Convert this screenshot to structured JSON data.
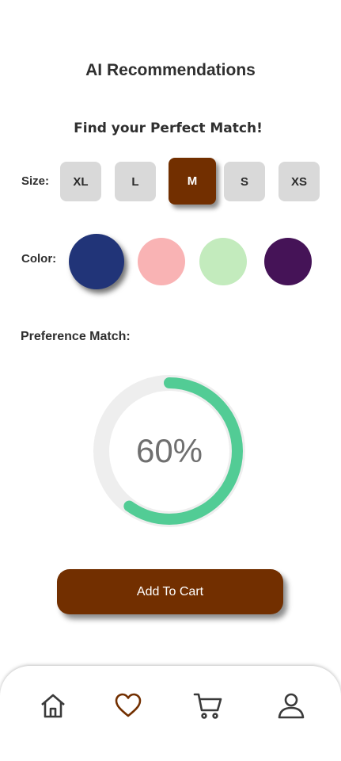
{
  "header": {
    "title": "AI Recommendations"
  },
  "subtitle": "Find your Perfect Match!",
  "size": {
    "label": "Size:",
    "options": [
      "XL",
      "L",
      "M",
      "S",
      "XS"
    ],
    "selected": "M"
  },
  "color": {
    "label": "Color:",
    "options": [
      {
        "name": "navy",
        "hex": "#213478"
      },
      {
        "name": "pink",
        "hex": "#f9b3b4"
      },
      {
        "name": "light-green",
        "hex": "#c3ebbd"
      },
      {
        "name": "purple",
        "hex": "#451357"
      }
    ],
    "selected": "navy"
  },
  "preference": {
    "label": "Preference Match:",
    "value_text": "60%",
    "value": 0.6,
    "ring_color": "#52cc95",
    "track_color": "#eeeeee"
  },
  "cart_button": {
    "label": "Add To Cart"
  },
  "accent_color": "#722f00",
  "nav": {
    "items": [
      {
        "name": "home",
        "icon": "home-icon"
      },
      {
        "name": "favorites",
        "icon": "heart-icon"
      },
      {
        "name": "cart",
        "icon": "cart-icon"
      },
      {
        "name": "profile",
        "icon": "user-icon"
      }
    ]
  }
}
